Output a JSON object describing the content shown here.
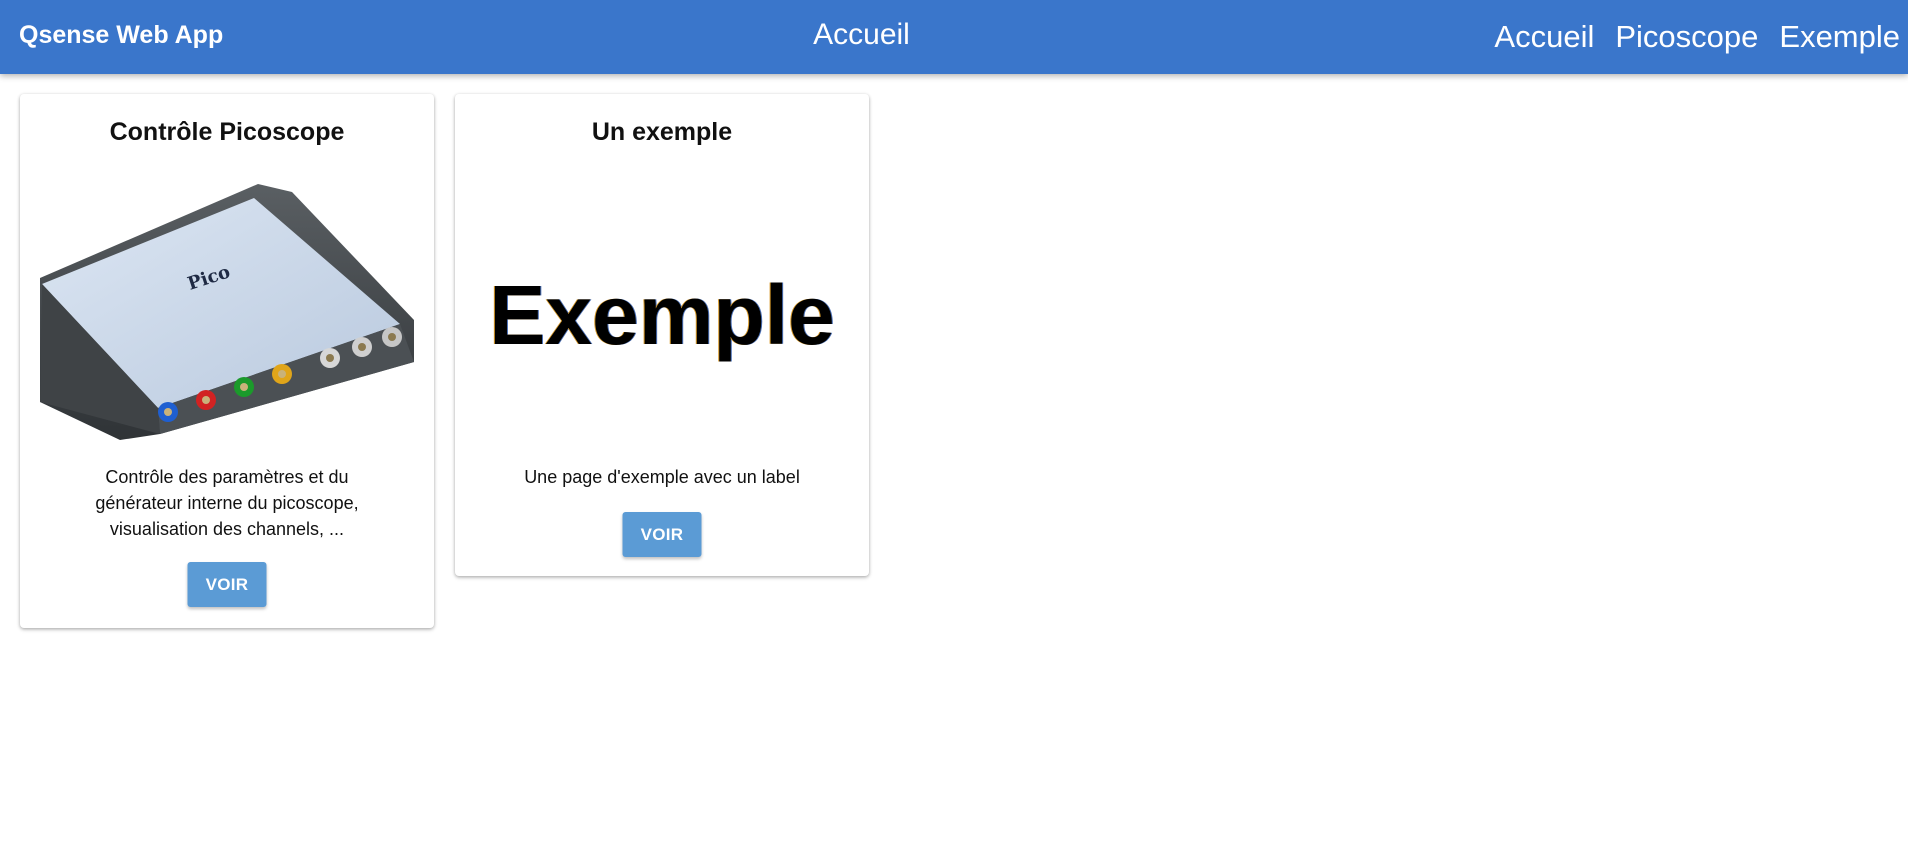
{
  "header": {
    "app_title": "Qsense Web App",
    "page_title": "Accueil",
    "nav": [
      {
        "label": "Accueil"
      },
      {
        "label": "Picoscope"
      },
      {
        "label": "Exemple"
      }
    ],
    "background_color": "#3a76cb"
  },
  "cards": [
    {
      "title": "Contrôle Picoscope",
      "image_icon": "picoscope-device-image",
      "description": "Contrôle des paramètres et du générateur interne du picoscope, visualisation des channels, ...",
      "button_label": "VOIR"
    },
    {
      "title": "Un exemple",
      "image_text": "Exemple",
      "description": "Une page d'exemple avec un label",
      "button_label": "VOIR"
    }
  ],
  "colors": {
    "button": "#5b9bd5",
    "header": "#3a76cb"
  }
}
